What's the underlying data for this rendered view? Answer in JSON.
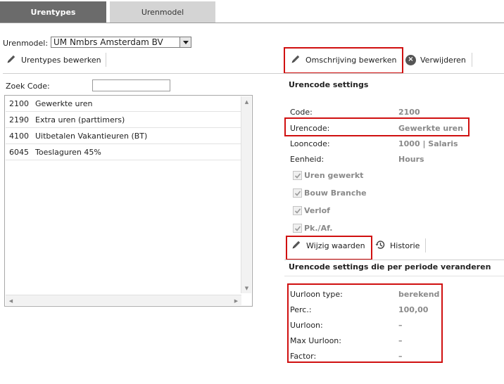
{
  "tabs": [
    {
      "label": "Urentypes",
      "active": true
    },
    {
      "label": "Urenmodel",
      "active": false
    }
  ],
  "urenmodel": {
    "label": "Urenmodel:",
    "selected": "UM Nmbrs Amsterdam BV"
  },
  "left_toolbar": {
    "edit_label": "Urentypes bewerken",
    "edit_icon": "pencil-icon"
  },
  "right_toolbar": {
    "edit_description_label": "Omschrijving bewerken",
    "delete_label": "Verwijderen",
    "edit_icon": "pencil-icon",
    "delete_icon": "circle-x-icon"
  },
  "search": {
    "label": "Zoek Code:",
    "value": ""
  },
  "urentypes": [
    {
      "code": "2100",
      "name": "Gewerkte uren"
    },
    {
      "code": "2190",
      "name": "Extra uren (parttimers)"
    },
    {
      "code": "4100",
      "name": "Uitbetalen Vakantieuren (BT)"
    },
    {
      "code": "6045",
      "name": "Toeslaguren 45%"
    }
  ],
  "settings": {
    "title": "Urencode settings",
    "fields": [
      {
        "label": "Code:",
        "value": "2100"
      },
      {
        "label": "Urencode:",
        "value": "Gewerkte uren"
      },
      {
        "label": "Looncode:",
        "value": "1000 | Salaris"
      },
      {
        "label": "Eenheid:",
        "value": "Hours"
      }
    ],
    "checkboxes": [
      {
        "label": "Uren gewerkt",
        "checked": true
      },
      {
        "label": "Bouw Branche",
        "checked": true
      },
      {
        "label": "Verlof",
        "checked": true
      },
      {
        "label": "Pk./Af.",
        "checked": true
      }
    ],
    "change_values_label": "Wijzig waarden",
    "history_label": "Historie"
  },
  "period_settings": {
    "title": "Urencode settings die per periode veranderen",
    "fields": [
      {
        "label": "Uurloon type:",
        "value": "berekend"
      },
      {
        "label": "Perc.:",
        "value": "100,00"
      },
      {
        "label": "Uurloon:",
        "value": "–"
      },
      {
        "label": "Max Uurloon:",
        "value": "–"
      },
      {
        "label": "Factor:",
        "value": "–"
      }
    ]
  },
  "colors": {
    "highlight": "#d01010",
    "tab_active": "#6b6b6b",
    "tab_inactive": "#d4d4d4",
    "value_gray": "#8a8a8a"
  }
}
